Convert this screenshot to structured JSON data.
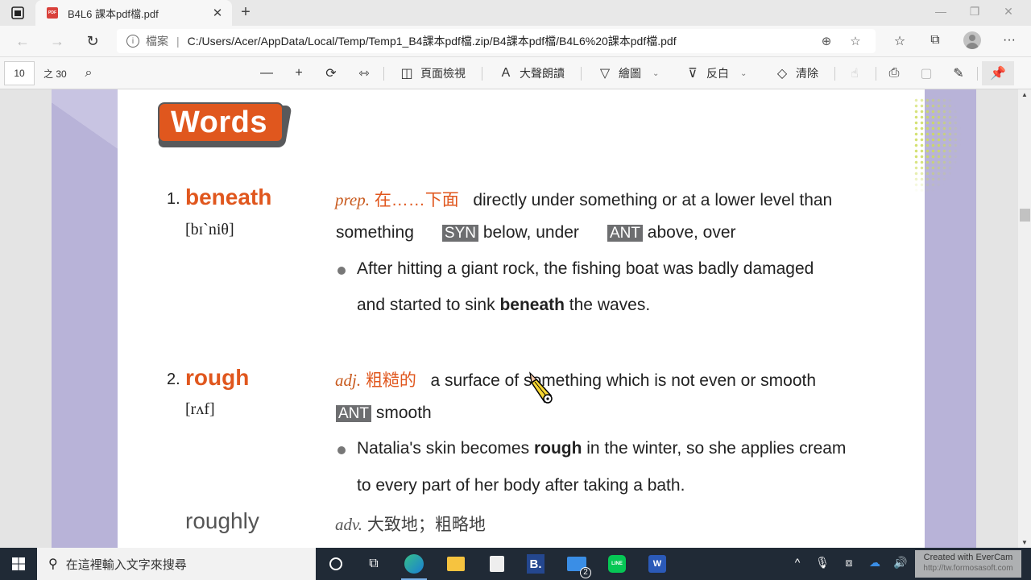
{
  "browser": {
    "tab_title": "B4L6 課本pdf檔.pdf",
    "tab_icon": "pdf-icon",
    "address": {
      "label": "檔案",
      "url": "C:/Users/Acer/AppData/Local/Temp/Temp1_B4課本pdf檔.zip/B4課本pdf檔/B4L6%20課本pdf檔.pdf"
    }
  },
  "pdf_toolbar": {
    "page_current": "10",
    "page_total": "之 30",
    "page_view_label": "頁面檢視",
    "read_aloud_label": "大聲朗讀",
    "draw_label": "繪圖",
    "highlight_label": "反白",
    "erase_label": "清除"
  },
  "document": {
    "badge": "Words",
    "entries": [
      {
        "number": "1.",
        "word": "beneath",
        "phonetic": "[bɪˋniθ]",
        "pos": "prep.",
        "zh": "在……下面",
        "def_line1": "directly under something or at a lower level than",
        "def_line2": "something",
        "syn_tag": "SYN",
        "syn": "below, under",
        "ant_tag": "ANT",
        "ant": "above, over",
        "example": {
          "line1": "After hitting a giant rock, the fishing boat was badly damaged",
          "line2_pre": "and started to sink ",
          "bold": "beneath",
          "line2_post": " the waves."
        }
      },
      {
        "number": "2.",
        "word": "rough",
        "phonetic": "[rʌf]",
        "pos": "adj.",
        "zh": "粗糙的",
        "def_line1": "a surface of something which is not even or smooth",
        "ant_tag": "ANT",
        "ant": "smooth",
        "example": {
          "line1_pre": "Natalia's skin becomes ",
          "bold": "rough",
          "line1_post": " in the winter, so she applies cream",
          "line2": "to every part of her body after taking a bath."
        },
        "derived": {
          "word": "roughly",
          "pos": "adv.",
          "zh": "大致地；粗略地"
        }
      }
    ]
  },
  "taskbar": {
    "search_placeholder": "在這裡輸入文字來搜尋",
    "mail_badge": "2",
    "watermark_line1": "Created with EverCam",
    "watermark_line2": "http://tw.formosasoft.com"
  },
  "colors": {
    "accent_orange": "#e0571e",
    "tag_gray": "#6d6e70",
    "page_band": "#b8b3d8"
  }
}
